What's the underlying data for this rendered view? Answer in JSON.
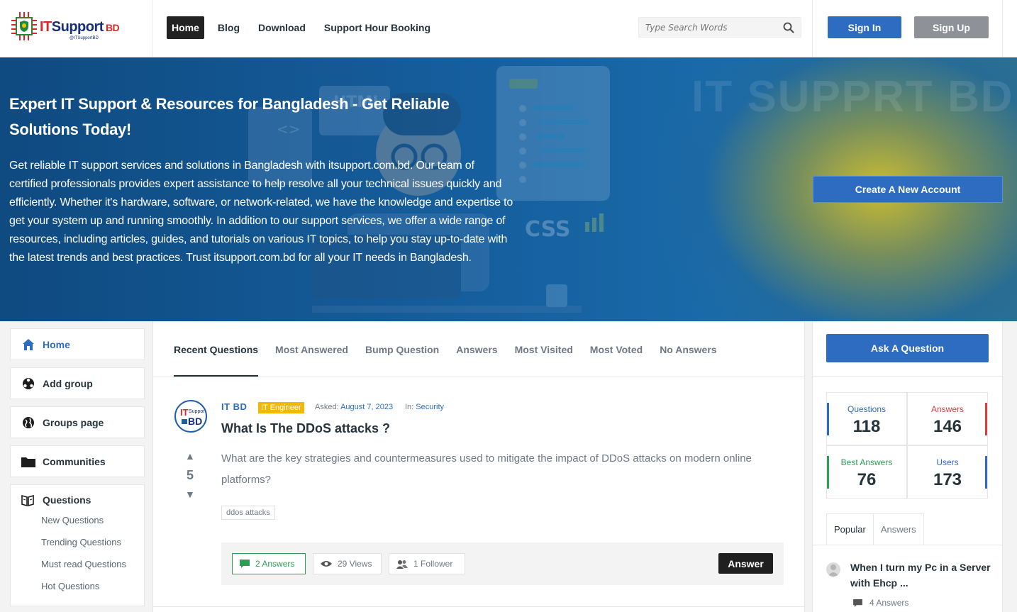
{
  "header": {
    "logo": {
      "it": "IT",
      "support": "Support",
      "bd": "BD",
      "handle": "@ITSupportBD"
    },
    "nav": [
      {
        "label": "Home",
        "active": true
      },
      {
        "label": "Blog"
      },
      {
        "label": "Download"
      },
      {
        "label": "Support Hour Booking"
      }
    ],
    "search": {
      "placeholder": "Type Search Words",
      "value": ""
    },
    "sign_in": "Sign In",
    "sign_up": "Sign Up"
  },
  "hero": {
    "title": "Expert IT Support & Resources for Bangladesh - Get Reliable Solutions Today!",
    "text": "Get reliable IT support services and solutions in Bangladesh with itsupport.com.bd. Our team of certified professionals provides expert assistance to help resolve all your technical issues quickly and efficiently. Whether it's hardware, software, or network-related, we have the knowledge and expertise to get your system up and running smoothly. In addition to our support services, we offer a wide range of resources, including articles, guides, and tutorials on various IT topics, to help you stay up-to-date with the latest trends and best practices. Trust itsupport.com.bd for all your IT needs in Bangladesh.",
    "watermark": "IT SUPPRT BD",
    "create_account": "Create A New Account"
  },
  "sidebar": {
    "items": [
      {
        "label": "Home",
        "icon": "home-icon"
      },
      {
        "label": "Add group",
        "icon": "group-add-icon"
      },
      {
        "label": "Groups page",
        "icon": "globe-icon"
      },
      {
        "label": "Communities",
        "icon": "folder-icon"
      }
    ],
    "questions": {
      "label": "Questions",
      "icon": "book-icon",
      "sub": [
        "New Questions",
        "Trending Questions",
        "Must read Questions",
        "Hot Questions"
      ]
    }
  },
  "main": {
    "tabs": [
      "Recent Questions",
      "Most Answered",
      "Bump Question",
      "Answers",
      "Most Visited",
      "Most Voted",
      "No Answers"
    ],
    "question": {
      "author": "IT BD",
      "badge": "IT Engineer",
      "asked_label": "Asked:",
      "asked_date": "August 7, 2023",
      "in_label": "In:",
      "category": "Security",
      "title": "What Is The DDoS attacks ?",
      "votes": "5",
      "body": "What are the key strategies and countermeasures used to mitigate the impact of DDoS attacks on modern online platforms?",
      "tag": "ddos attacks",
      "answers": "2 Answers",
      "views": "29 Views",
      "followers": "1 Follower",
      "answer_button": "Answer"
    }
  },
  "right": {
    "ask_button": "Ask A Question",
    "stats": [
      {
        "label": "Questions",
        "value": "118",
        "color": "#2d6cc0"
      },
      {
        "label": "Answers",
        "value": "146",
        "color": "#e0393e"
      },
      {
        "label": "Best Answers",
        "value": "76",
        "color": "#2e9e56"
      },
      {
        "label": "Users",
        "value": "173",
        "color": "#2d6cc0"
      }
    ],
    "tabs": [
      "Popular",
      "Answers"
    ],
    "popular": {
      "title": "When I turn my Pc in a Server with Ehcp ...",
      "answers": "4 Answers"
    }
  }
}
